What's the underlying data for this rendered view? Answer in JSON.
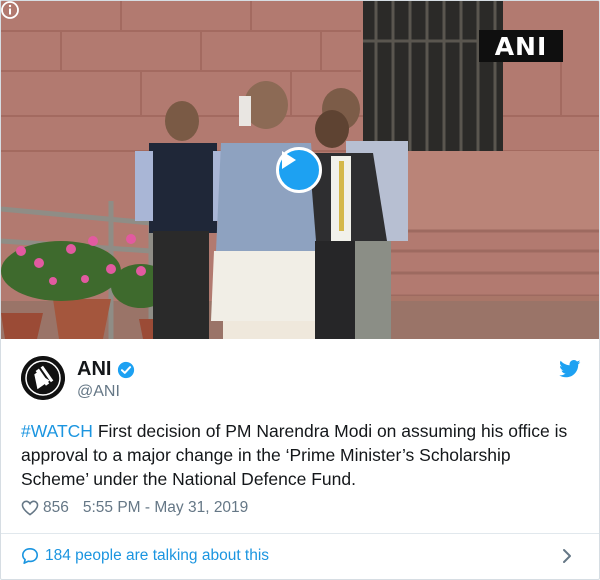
{
  "media": {
    "watermark": "ANI",
    "colors": {
      "play_button": "#1da1f2",
      "brick": "#b07468"
    }
  },
  "tweet": {
    "author_name": "ANI",
    "author_handle": "@ANI",
    "text_hashtag": "#WATCH",
    "text_body": " First decision of PM Narendra Modi on assuming his office is approval to a major change in the ‘Prime Minister’s Scholarship Scheme’ under the National Defence Fund.",
    "like_count": "856",
    "timestamp": "5:55 PM - May 31, 2019",
    "conversation_label": "184 people are talking about this",
    "colors": {
      "link": "#1b95e0",
      "muted": "#657786",
      "verified": "#1da1f2"
    }
  }
}
